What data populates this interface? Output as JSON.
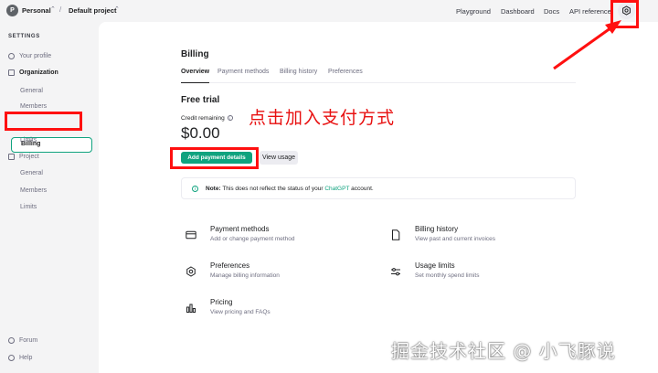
{
  "topbar": {
    "workspace_initial": "P",
    "workspace_name": "Personal",
    "separator": "/",
    "project_name": "Default project",
    "nav": [
      "Playground",
      "Dashboard",
      "Docs",
      "API reference"
    ]
  },
  "sidebar": {
    "section_title": "SETTINGS",
    "your_profile": "Your profile",
    "organization": "Organization",
    "org_items": [
      "General",
      "Members",
      "Billing",
      "Limits"
    ],
    "project": "Project",
    "project_items": [
      "General",
      "Members",
      "Limits"
    ],
    "forum": "Forum",
    "help": "Help"
  },
  "billing": {
    "title": "Billing",
    "tabs": [
      "Overview",
      "Payment methods",
      "Billing history",
      "Preferences"
    ],
    "plan": "Free trial",
    "credit_label": "Credit remaining",
    "credit_amount": "$0.00",
    "add_payment_button": "Add payment details",
    "view_usage_button": "View usage",
    "notice_bold": "Note:",
    "notice_text": "This does not reflect the status of your",
    "notice_link": "ChatGPT",
    "notice_tail": "account."
  },
  "cards": [
    {
      "title": "Payment methods",
      "desc": "Add or change payment method",
      "icon": "credit-card-icon"
    },
    {
      "title": "Billing history",
      "desc": "View past and current invoices",
      "icon": "document-icon"
    },
    {
      "title": "Preferences",
      "desc": "Manage billing information",
      "icon": "gear-icon"
    },
    {
      "title": "Usage limits",
      "desc": "Set monthly spend limits",
      "icon": "sliders-icon"
    },
    {
      "title": "Pricing",
      "desc": "View pricing and FAQs",
      "icon": "bar-chart-icon"
    }
  ],
  "annotation": {
    "instruction": "点击加入支付方式",
    "color": "#ff1010"
  },
  "watermark": "掘金技术社区 @ 小飞豚说",
  "colors": {
    "accent": "#10a37f",
    "annotation_red": "#ff1010"
  }
}
